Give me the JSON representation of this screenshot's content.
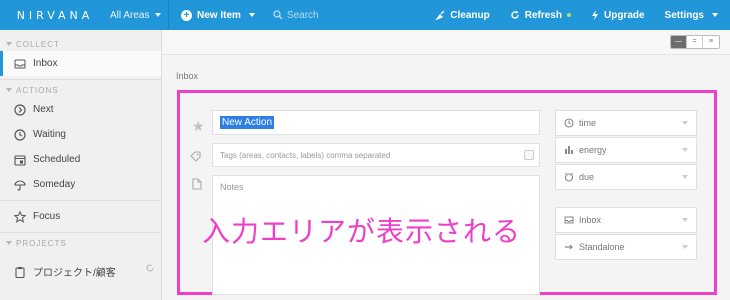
{
  "topbar": {
    "logo": "NIRVANA",
    "areas": "All Areas",
    "new_item": "New Item",
    "search_placeholder": "Search",
    "cleanup": "Cleanup",
    "refresh": "Refresh",
    "upgrade": "Upgrade",
    "settings": "Settings"
  },
  "sidebar": {
    "collect_header": "COLLECT",
    "inbox": "Inbox",
    "actions_header": "ACTIONS",
    "next": "Next",
    "waiting": "Waiting",
    "scheduled": "Scheduled",
    "someday": "Someday",
    "focus": "Focus",
    "projects_header": "PROJECTS",
    "project_item": "プロジェクト/顧客"
  },
  "main": {
    "view_buttons": [
      "—",
      "=",
      "≡"
    ],
    "section_title": "Inbox",
    "title_value": "New Action",
    "tags_placeholder": "Tags (areas, contacts, labels) comma separated",
    "notes_placeholder": "Notes",
    "time": "time",
    "energy": "energy",
    "due": "due",
    "list": "Inbox",
    "project": "Standalone",
    "annotation": "入力エリアが表示される"
  },
  "colors": {
    "topbar": "#2196d8",
    "highlight": "#ee3fc9"
  }
}
